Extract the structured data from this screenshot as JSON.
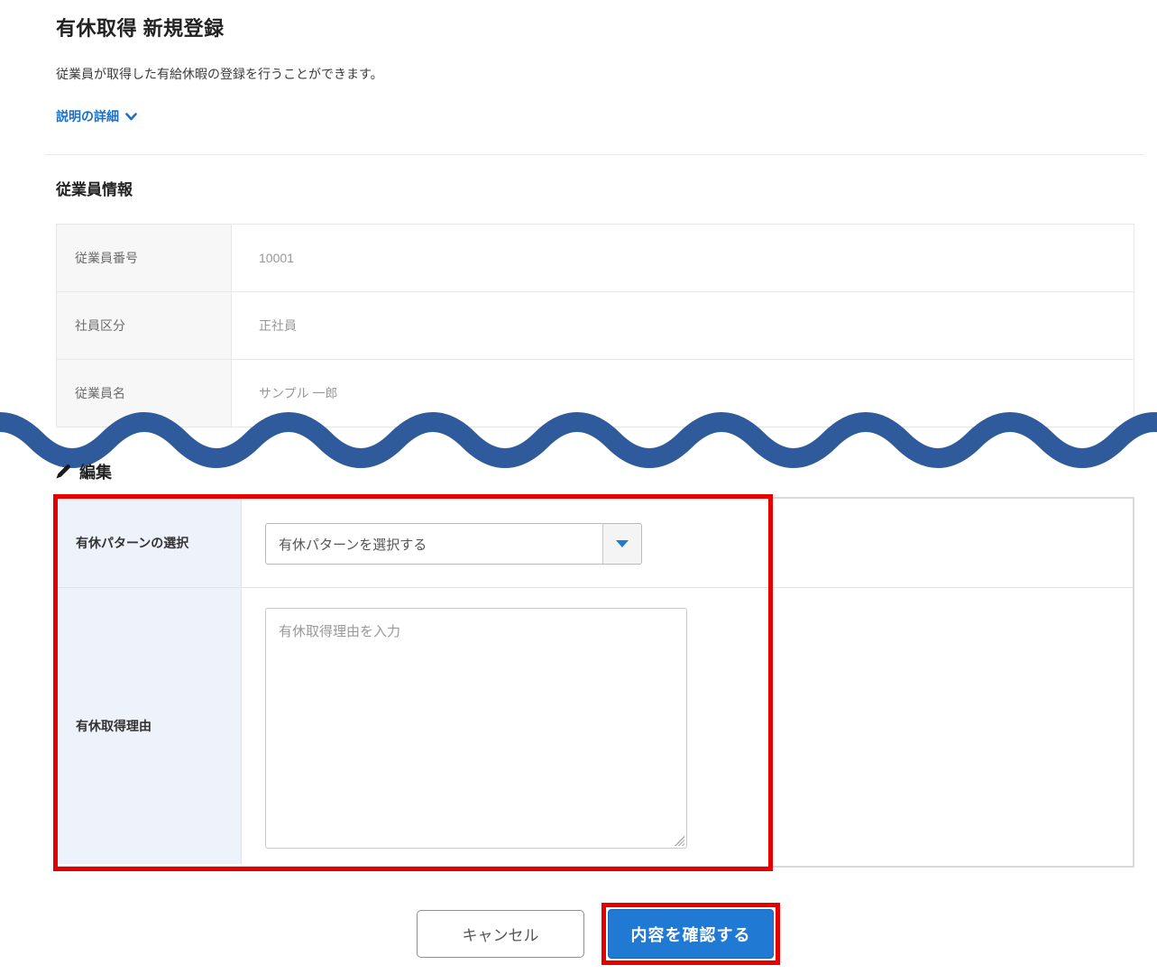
{
  "page": {
    "title": "有休取得 新規登録",
    "description": "従業員が取得した有給休暇の登録を行うことができます。",
    "detail_link_label": "説明の詳細"
  },
  "employee_section": {
    "heading": "従業員情報",
    "rows": [
      {
        "label": "従業員番号",
        "value": "10001"
      },
      {
        "label": "社員区分",
        "value": "正社員"
      },
      {
        "label": "従業員名",
        "value": "サンプル 一郎"
      }
    ]
  },
  "edit_section": {
    "heading": "編集",
    "pattern_row": {
      "label": "有休パターンの選択",
      "select_value": "有休パターンを選択する"
    },
    "reason_row": {
      "label": "有休取得理由",
      "placeholder": "有休取得理由を入力"
    }
  },
  "actions": {
    "cancel_label": "キャンセル",
    "confirm_label": "内容を確認する"
  },
  "icons": {
    "detail_chevron": "chevron-down-icon",
    "edit_pencil": "pencil-icon",
    "select_arrow": "triangle-down-icon"
  },
  "colors": {
    "accent_blue": "#2079d2",
    "link_blue": "#1b6fc9",
    "wave_blue": "#2f5b9d",
    "annotation_red": "#e60000",
    "label_bg_gray": "#f7f7f7",
    "label_bg_blue": "#eef2fa"
  }
}
